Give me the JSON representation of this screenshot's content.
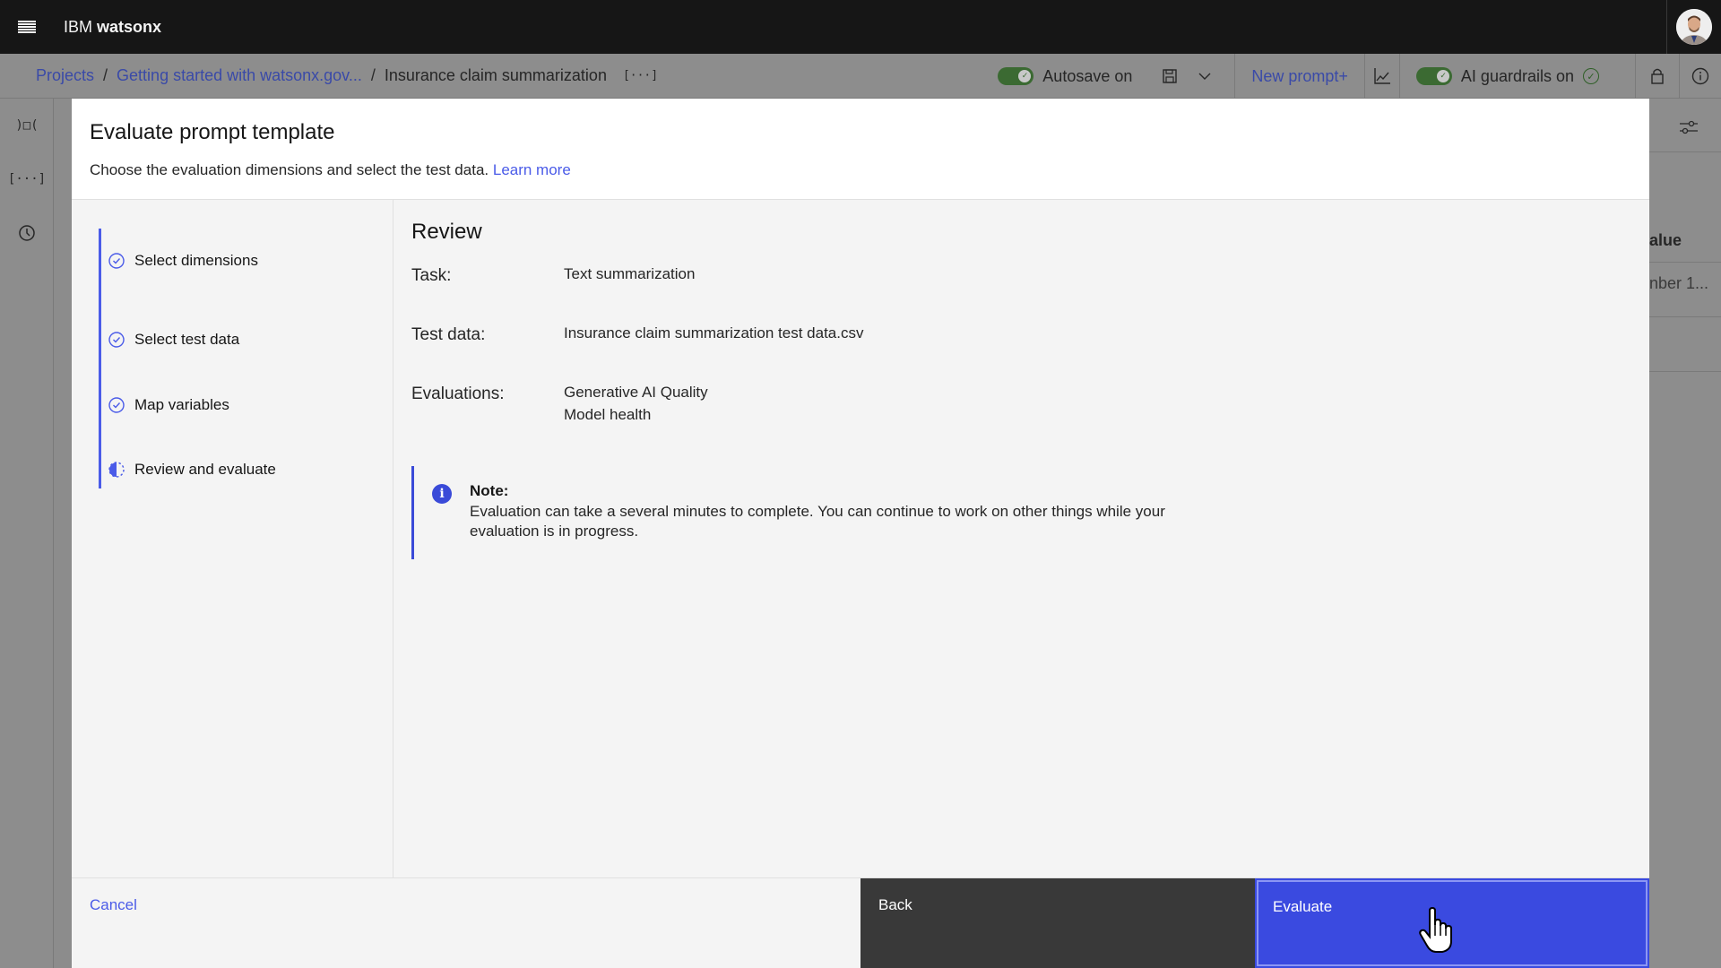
{
  "app": {
    "brand_prefix": "IBM",
    "brand_name": "watsonx"
  },
  "breadcrumb": {
    "items": [
      {
        "label": "Projects"
      },
      {
        "label": "Getting started with watsonx.gov..."
      }
    ],
    "separator": "/",
    "current": "Insurance claim summarization",
    "variables_icon": "[···]"
  },
  "toolbar": {
    "autosave_label": "Autosave on",
    "new_prompt_label": "New prompt",
    "new_prompt_plus": "+",
    "guardrails_label": "AI guardrails on",
    "autosave_enabled": true,
    "guardrails_enabled": true
  },
  "rail": {
    "icons": [
      "compare-icon",
      "variables-icon",
      "history-icon"
    ],
    "compare_glyph": ")□(",
    "variables_glyph": "[···]"
  },
  "background_table": {
    "column_header": "alue",
    "cell": "nber 1..."
  },
  "modal": {
    "title": "Evaluate prompt template",
    "subtitle": "Choose the evaluation dimensions and select the test data.",
    "learn_more": "Learn more",
    "steps": [
      {
        "label": "Select dimensions",
        "status": "complete"
      },
      {
        "label": "Select test data",
        "status": "complete"
      },
      {
        "label": "Map variables",
        "status": "complete"
      },
      {
        "label": "Review and evaluate",
        "status": "current"
      }
    ],
    "review": {
      "heading": "Review",
      "task_label": "Task:",
      "task_value": "Text summarization",
      "test_data_label": "Test data:",
      "test_data_value": "Insurance claim summarization test data.csv",
      "evaluations_label": "Evaluations:",
      "evaluations": [
        "Generative AI Quality",
        "Model health"
      ]
    },
    "note": {
      "title": "Note:",
      "text": "Evaluation can take a several minutes to complete. You can continue to work on other things while your evaluation is in progress."
    },
    "footer": {
      "cancel": "Cancel",
      "back": "Back",
      "evaluate": "Evaluate"
    }
  },
  "colors": {
    "accent": "#4a5be8",
    "primary_button": "#3a4ae0",
    "secondary_button": "#393939",
    "toggle_on": "#3b6a32",
    "topbar": "#161616"
  }
}
